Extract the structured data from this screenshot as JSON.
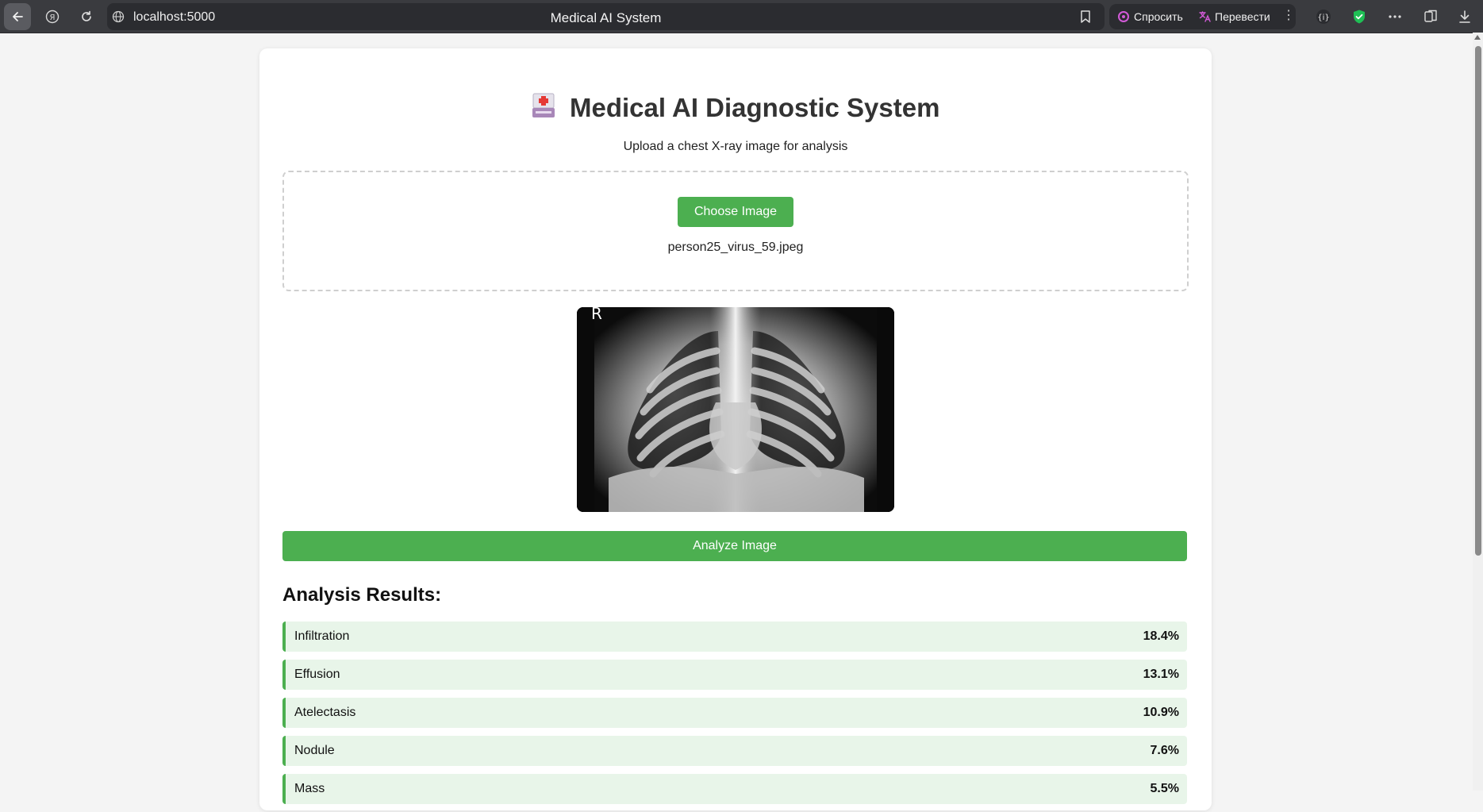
{
  "browser": {
    "url": "localhost:5000",
    "page_title": "Medical AI System",
    "ask_label": "Спросить",
    "translate_label": "Перевести"
  },
  "page": {
    "title": "Medical AI Diagnostic System",
    "title_icon": "medical-kit-icon",
    "subtitle": "Upload a chest X-ray image for analysis",
    "choose_button": "Choose Image",
    "file_name": "person25_virus_59.jpeg",
    "xray_marker": "R",
    "analyze_button": "Analyze Image",
    "results_heading": "Analysis Results:"
  },
  "results": [
    {
      "label": "Infiltration",
      "value": "18.4%"
    },
    {
      "label": "Effusion",
      "value": "13.1%"
    },
    {
      "label": "Atelectasis",
      "value": "10.9%"
    },
    {
      "label": "Nodule",
      "value": "7.6%"
    },
    {
      "label": "Mass",
      "value": "5.5%"
    }
  ],
  "colors": {
    "accent": "#4caf50",
    "result_bg": "#e8f5e9",
    "chrome_bg": "#3a3b3f"
  }
}
